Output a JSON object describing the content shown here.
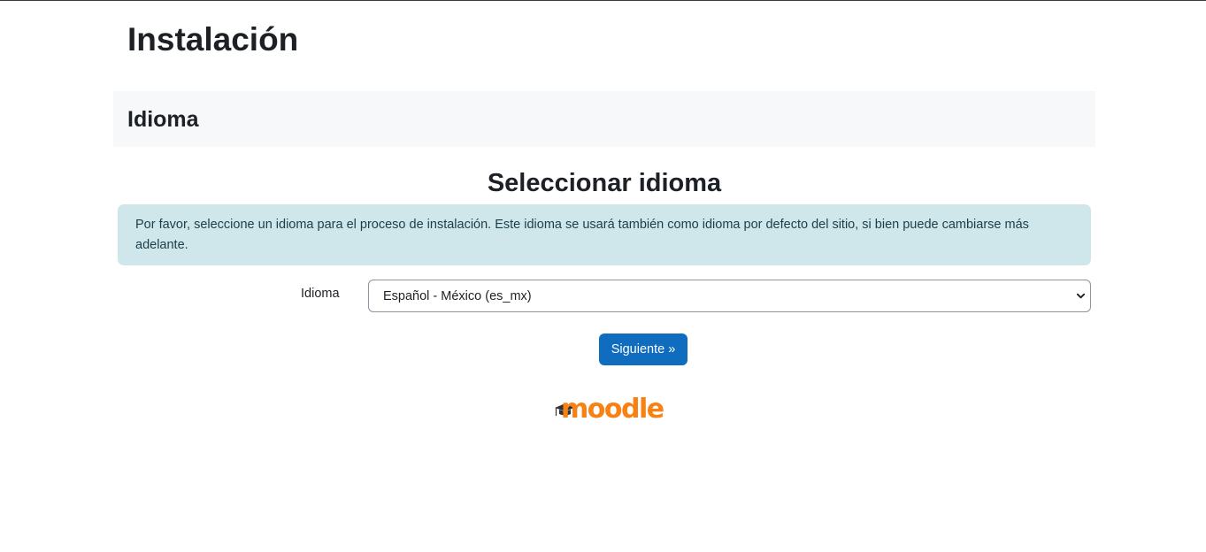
{
  "page": {
    "title": "Instalación"
  },
  "section": {
    "heading": "Idioma"
  },
  "main": {
    "subtitle": "Seleccionar idioma",
    "info_message": "Por favor, seleccione un idioma para el proceso de instalación. Este idioma se usará también como idioma por defecto del sitio, si bien puede cambiarse más adelante."
  },
  "form": {
    "language_label": "Idioma",
    "language_selected": "Español - México (es_mx)",
    "next_button_label": "Siguiente »"
  },
  "footer": {
    "logo_text": "moodle",
    "logo_icon": "graduation-cap-icon"
  },
  "colors": {
    "primary_button": "#0f6cbf",
    "info_background": "#cfe7ea",
    "brand_orange": "#f98012",
    "section_background": "#f7f8fa"
  }
}
